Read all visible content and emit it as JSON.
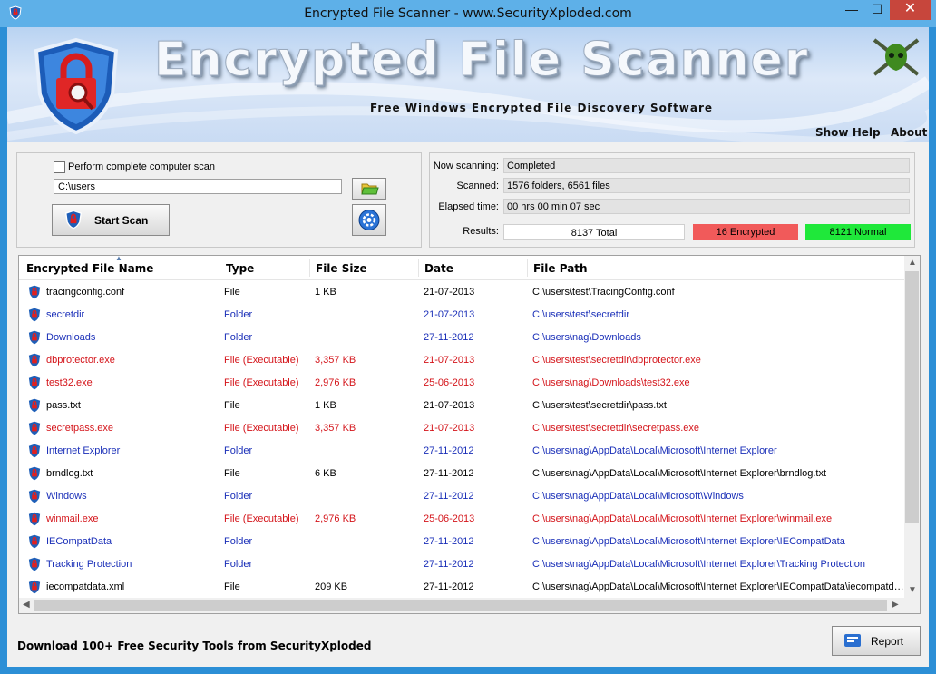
{
  "window": {
    "title": "Encrypted File Scanner - www.SecurityXploded.com",
    "minimize": "—",
    "maximize": "☐",
    "close": "✕"
  },
  "banner": {
    "title": "Encrypted File Scanner",
    "subtitle": "Free Windows Encrypted File Discovery Software",
    "show_help": "Show Help",
    "about": "About"
  },
  "scan": {
    "complete_scan_label": "Perform complete computer scan",
    "path_value": "C:\\users",
    "start_label": "Start Scan"
  },
  "status": {
    "now_scanning_label": "Now scanning:",
    "now_scanning_value": "Completed",
    "scanned_label": "Scanned:",
    "scanned_value": "1576 folders, 6561 files",
    "elapsed_label": "Elapsed time:",
    "elapsed_value": "00 hrs 00 min 07 sec",
    "results_label": "Results:",
    "total": "8137 Total",
    "encrypted": "16 Encrypted",
    "normal": "8121 Normal"
  },
  "colors": {
    "file": "#000000",
    "folder": "#1a2fb8",
    "executable": "#d4141a"
  },
  "table": {
    "headers": [
      "Encrypted File Name",
      "Type",
      "File Size",
      "Date",
      "File Path"
    ],
    "rows": [
      {
        "name": "tracingconfig.conf",
        "type": "File",
        "size": "1 KB",
        "date": "21-07-2013",
        "path": "C:\\users\\test\\TracingConfig.conf",
        "kind": "file"
      },
      {
        "name": "secretdir",
        "type": "Folder",
        "size": "",
        "date": "21-07-2013",
        "path": "C:\\users\\test\\secretdir",
        "kind": "folder"
      },
      {
        "name": "Downloads",
        "type": "Folder",
        "size": "",
        "date": "27-11-2012",
        "path": "C:\\users\\nag\\Downloads",
        "kind": "folder"
      },
      {
        "name": "dbprotector.exe",
        "type": "File (Executable)",
        "size": "3,357 KB",
        "date": "21-07-2013",
        "path": "C:\\users\\test\\secretdir\\dbprotector.exe",
        "kind": "executable"
      },
      {
        "name": "test32.exe",
        "type": "File (Executable)",
        "size": "2,976 KB",
        "date": "25-06-2013",
        "path": "C:\\users\\nag\\Downloads\\test32.exe",
        "kind": "executable"
      },
      {
        "name": "pass.txt",
        "type": "File",
        "size": "1 KB",
        "date": "21-07-2013",
        "path": "C:\\users\\test\\secretdir\\pass.txt",
        "kind": "file"
      },
      {
        "name": "secretpass.exe",
        "type": "File (Executable)",
        "size": "3,357 KB",
        "date": "21-07-2013",
        "path": "C:\\users\\test\\secretdir\\secretpass.exe",
        "kind": "executable"
      },
      {
        "name": "Internet Explorer",
        "type": "Folder",
        "size": "",
        "date": "27-11-2012",
        "path": "C:\\users\\nag\\AppData\\Local\\Microsoft\\Internet Explorer",
        "kind": "folder"
      },
      {
        "name": "brndlog.txt",
        "type": "File",
        "size": "6 KB",
        "date": "27-11-2012",
        "path": "C:\\users\\nag\\AppData\\Local\\Microsoft\\Internet Explorer\\brndlog.txt",
        "kind": "file"
      },
      {
        "name": "Windows",
        "type": "Folder",
        "size": "",
        "date": "27-11-2012",
        "path": "C:\\users\\nag\\AppData\\Local\\Microsoft\\Windows",
        "kind": "folder"
      },
      {
        "name": "winmail.exe",
        "type": "File (Executable)",
        "size": "2,976 KB",
        "date": "25-06-2013",
        "path": "C:\\users\\nag\\AppData\\Local\\Microsoft\\Internet Explorer\\winmail.exe",
        "kind": "executable"
      },
      {
        "name": "IECompatData",
        "type": "Folder",
        "size": "",
        "date": "27-11-2012",
        "path": "C:\\users\\nag\\AppData\\Local\\Microsoft\\Internet Explorer\\IECompatData",
        "kind": "folder"
      },
      {
        "name": "Tracking Protection",
        "type": "Folder",
        "size": "",
        "date": "27-11-2012",
        "path": "C:\\users\\nag\\AppData\\Local\\Microsoft\\Internet Explorer\\Tracking Protection",
        "kind": "folder"
      },
      {
        "name": "iecompatdata.xml",
        "type": "File",
        "size": "209 KB",
        "date": "27-11-2012",
        "path": "C:\\users\\nag\\AppData\\Local\\Microsoft\\Internet Explorer\\IECompatData\\iecompatdata.xml",
        "kind": "file"
      }
    ]
  },
  "footer": {
    "text": "Download 100+ Free Security Tools from SecurityXploded",
    "report_label": "Report"
  },
  "icons": {
    "app": "shield-lock-icon",
    "row": "shield-lock-icon",
    "browse": "folder-icon",
    "settings": "gear-icon",
    "report": "report-icon",
    "logo": "pirate-swords-icon"
  }
}
